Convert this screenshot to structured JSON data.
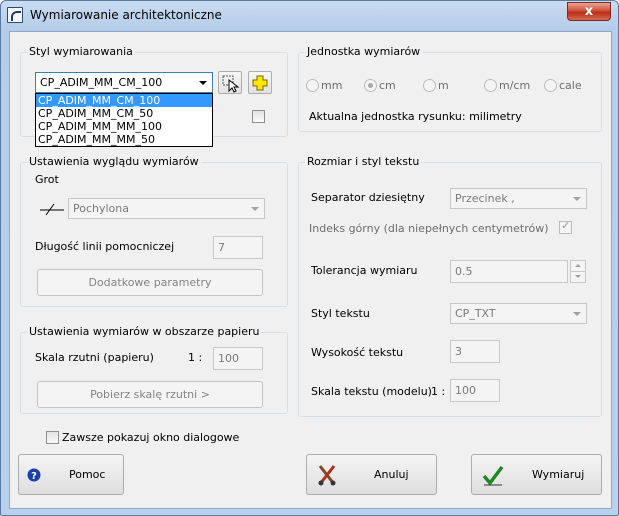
{
  "window": {
    "title": "Wymiarowanie architektoniczne",
    "close_glyph": "x"
  },
  "dim_style": {
    "group_title": "Styl wymiarowania",
    "selected": "CP_ADIM_MM_CM_100",
    "options": [
      "CP_ADIM_MM_CM_100",
      "CP_ADIM_MM_CM_50",
      "CP_ADIM_MM_MM_100",
      "CP_ADIM_MM_MM_50"
    ],
    "pick_icon": "cursor-pick-icon",
    "add_icon": "plus-icon"
  },
  "units": {
    "group_title": "Jednostka wymiarów",
    "options": [
      {
        "label": "mm",
        "checked": false
      },
      {
        "label": "cm",
        "checked": true
      },
      {
        "label": "m",
        "checked": false
      },
      {
        "label": "m/cm",
        "checked": false
      },
      {
        "label": "cale",
        "checked": false
      }
    ],
    "current_unit_text": "Aktualna jednostka rysunku: milimetry"
  },
  "appearance": {
    "group_title": "Ustawienia wyglądu wymiarów",
    "arrow_label": "Grot",
    "arrow_value": "Pochylona",
    "ext_line_label": "Długość linii pomocniczej",
    "ext_line_value": "7",
    "extra_params_button": "Dodatkowe parametry"
  },
  "paper": {
    "group_title": "Ustawienia wymiarów w obszarze papieru",
    "scale_label": "Skala rzutni (papieru)",
    "scale_prefix": "1 :",
    "scale_value": "100",
    "get_scale_button": "Pobierz skalę rzutni >"
  },
  "text": {
    "group_title": "Rozmiar i styl tekstu",
    "decimal_sep_label": "Separator dziesiętny",
    "decimal_sep_value": "Przecinek ,",
    "superscript_label": "Indeks górny (dla niepełnych centymetrów)",
    "superscript_checked": true,
    "tolerance_label": "Tolerancja wymiaru",
    "tolerance_value": "0.5",
    "text_style_label": "Styl tekstu",
    "text_style_value": "CP_TXT",
    "text_height_label": "Wysokość tekstu",
    "text_height_value": "3",
    "text_scale_label": "Skala tekstu (modelu)",
    "text_scale_prefix": "1 :",
    "text_scale_value": "100"
  },
  "footer": {
    "always_show_label": "Zawsze pokazuj okno dialogowe",
    "help_button": "Pomoc",
    "cancel_button": "Anuluj",
    "ok_button": "Wymiaruj",
    "help_icon": "help-icon",
    "cancel_icon": "cancel-icon",
    "ok_icon": "checkmark-icon"
  },
  "colors": {
    "selection": "#3399ff",
    "title_bar": "#b9d1ec",
    "close_button": "#c8402a"
  }
}
